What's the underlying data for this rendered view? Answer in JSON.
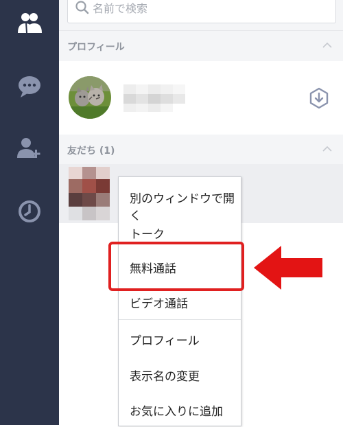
{
  "search": {
    "placeholder": "名前で検索"
  },
  "sections": {
    "profile": {
      "title": "プロフィール"
    },
    "friends": {
      "title": "友だち (1)"
    }
  },
  "context_menu": {
    "items": [
      "別のウィンドウで開く",
      "トーク",
      "無料通話",
      "ビデオ通話",
      "プロフィール",
      "表示名の変更",
      "お気に入りに追加"
    ],
    "highlighted": "無料通話"
  },
  "colors": {
    "sidebar": "#2c344a",
    "sidebar_icon_active": "#ffffff",
    "sidebar_icon": "#8a93ad",
    "highlight": "#e02020"
  },
  "icons": {
    "sidebar": [
      "friends-icon",
      "chat-icon",
      "add-friend-icon",
      "history-icon"
    ],
    "profile_action": "download-icon"
  }
}
